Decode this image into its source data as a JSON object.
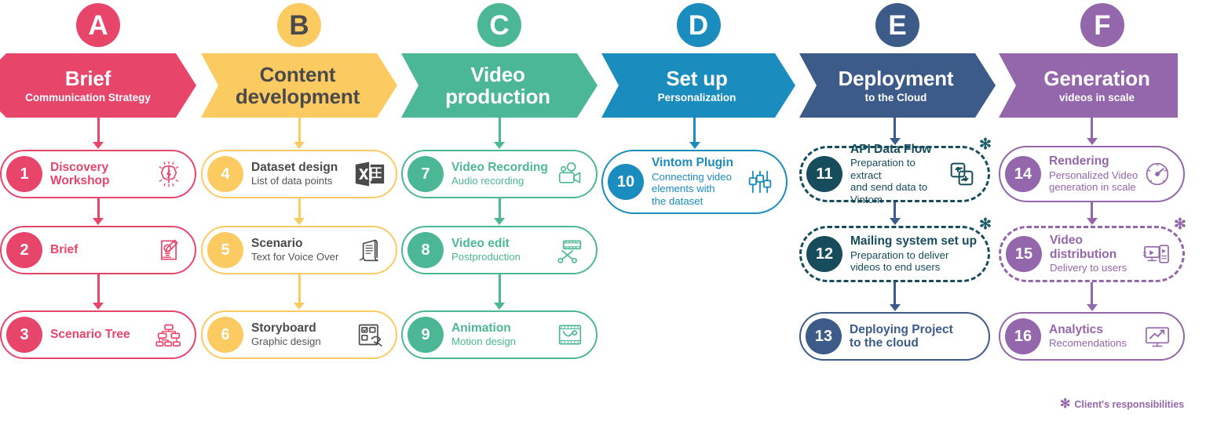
{
  "phases": [
    {
      "letter": "A",
      "title": "Brief",
      "subtitle": "Communication Strategy",
      "color": "#E8456B",
      "letter_text_color": "#ffffff",
      "header_text_color": "#ffffff",
      "cards": [
        {
          "num": "1",
          "title": "Discovery\nWorkshop",
          "sub": "",
          "icon": "brain-icon",
          "title_color": "#E8456B",
          "dashed": false,
          "star": false
        },
        {
          "num": "2",
          "title": "Brief",
          "sub": "",
          "icon": "brief-document-icon",
          "title_color": "#E8456B",
          "dashed": false,
          "star": false
        },
        {
          "num": "3",
          "title": "Scenario Tree",
          "sub": "",
          "icon": "tree-diagram-icon",
          "title_color": "#E8456B",
          "dashed": false,
          "star": false
        }
      ]
    },
    {
      "letter": "B",
      "title": "Content\ndevelopment",
      "subtitle": "",
      "color": "#FBCB62",
      "letter_text_color": "#4a4a4a",
      "header_text_color": "#4a4a4a",
      "cards": [
        {
          "num": "4",
          "title": "Dataset design",
          "sub": "List of data points",
          "icon": "spreadsheet-icon",
          "title_color": "#4a4a4a",
          "dashed": false,
          "star": false
        },
        {
          "num": "5",
          "title": "Scenario",
          "sub": "Text for Voice Over",
          "icon": "script-scroll-icon",
          "title_color": "#4a4a4a",
          "dashed": false,
          "star": false
        },
        {
          "num": "6",
          "title": "Storyboard",
          "sub": "Graphic design",
          "icon": "storyboard-icon",
          "title_color": "#4a4a4a",
          "dashed": false,
          "star": false
        }
      ]
    },
    {
      "letter": "C",
      "title": "Video\nproduction",
      "subtitle": "",
      "color": "#4CB795",
      "letter_text_color": "#ffffff",
      "header_text_color": "#ffffff",
      "cards": [
        {
          "num": "7",
          "title": "Video Recording",
          "sub": "Audio recording",
          "icon": "video-camera-icon",
          "title_color": "#4CB795",
          "dashed": false,
          "star": false
        },
        {
          "num": "8",
          "title": "Video edit",
          "sub": "Postproduction",
          "icon": "film-scissors-icon",
          "title_color": "#4CB795",
          "dashed": false,
          "star": false
        },
        {
          "num": "9",
          "title": "Animation",
          "sub": "Motion design",
          "icon": "film-motion-icon",
          "title_color": "#4CB795",
          "dashed": false,
          "star": false
        }
      ]
    },
    {
      "letter": "D",
      "title": "Set up",
      "subtitle": "Personalization",
      "color": "#1B8CBE",
      "letter_text_color": "#ffffff",
      "header_text_color": "#ffffff",
      "cards": [
        {
          "num": "10",
          "title": "Vintom Plugin",
          "sub": "Connecting video\nelements with\nthe dataset",
          "icon": "sliders-icon",
          "title_color": "#1B8CBE",
          "dashed": false,
          "star": false
        }
      ]
    },
    {
      "letter": "E",
      "title": "Deployment",
      "subtitle": "to the Cloud",
      "color": "#3C5B89",
      "letter_text_color": "#ffffff",
      "header_text_color": "#ffffff",
      "cards": [
        {
          "num": "11",
          "title": "API Data Flow",
          "sub": "Preparation to extract\nand send data to Vintom",
          "icon": "data-exchange-icon",
          "title_color": "#164C5B",
          "dashed": true,
          "star": true,
          "num_color": "#164C5B"
        },
        {
          "num": "12",
          "title": "Mailing system set up",
          "sub": "Preparation to deliver\nvideos to end users",
          "icon": "",
          "title_color": "#164C5B",
          "dashed": true,
          "star": true,
          "num_color": "#164C5B"
        },
        {
          "num": "13",
          "title": "Deploying Project\nto the cloud",
          "sub": "",
          "icon": "",
          "title_color": "#3C5B89",
          "dashed": false,
          "star": false
        }
      ]
    },
    {
      "letter": "F",
      "title": "Generation",
      "subtitle": "videos in scale",
      "color": "#9466AC",
      "letter_text_color": "#ffffff",
      "header_text_color": "#ffffff",
      "cards": [
        {
          "num": "14",
          "title": "Rendering",
          "sub": "Personalized Video\ngeneration in scale",
          "icon": "gauge-icon",
          "title_color": "#9466AC",
          "dashed": false,
          "star": false
        },
        {
          "num": "15",
          "title": "Video\ndistribution",
          "sub": "Delivery to users",
          "icon": "devices-icon",
          "title_color": "#9466AC",
          "dashed": true,
          "star": true
        },
        {
          "num": "16",
          "title": "Analytics",
          "sub": "Recomendations",
          "icon": "analytics-chart-icon",
          "title_color": "#9466AC",
          "dashed": false,
          "star": false
        }
      ]
    }
  ],
  "footnote": {
    "star": "✻",
    "label": "Client's responsibilities",
    "color": "#9466AC"
  }
}
